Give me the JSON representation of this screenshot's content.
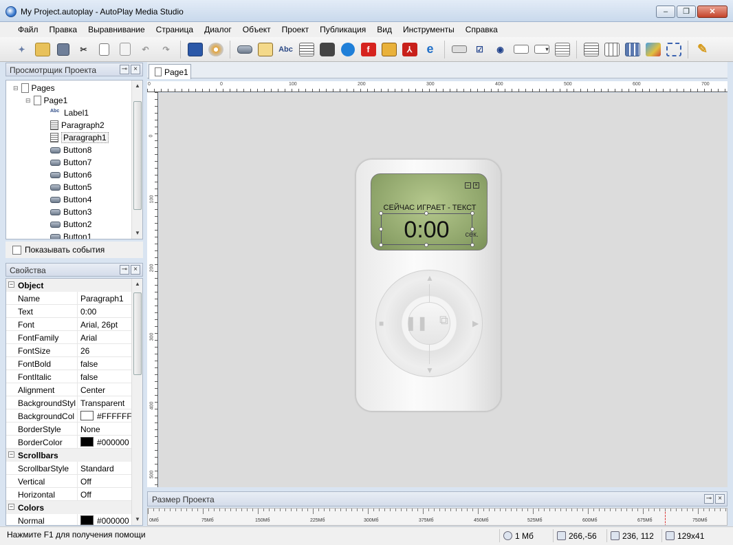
{
  "window": {
    "title": "My Project.autoplay - AutoPlay Media Studio",
    "minimize": "‒",
    "maximize": "❐",
    "close": "✕"
  },
  "menu": [
    "Файл",
    "Правка",
    "Выравнивание",
    "Страница",
    "Диалог",
    "Объект",
    "Проект",
    "Публикация",
    "Вид",
    "Инструменты",
    "Справка"
  ],
  "toolbar": {
    "text_label_icon": "Abc",
    "icons": [
      "wizard-icon",
      "open-folder-icon",
      "save-icon",
      "cut-icon",
      "copy-icon",
      "paste-icon",
      "undo-icon",
      "redo-icon",
      "preview-icon",
      "build-cd-icon",
      "button-object-icon",
      "image-object-icon",
      "label-object-icon",
      "paragraph-object-icon",
      "video-object-icon",
      "quicktime-object-icon",
      "flash-object-icon",
      "slideshow-object-icon",
      "pdf-object-icon",
      "web-object-icon",
      "input-object-icon",
      "checkbox-object-icon",
      "radio-object-icon",
      "input-text-object-icon",
      "combobox-object-icon",
      "listbox-object-icon",
      "grid-object-icon",
      "table-object-icon",
      "tree-object-icon",
      "plugin-object-icon",
      "select-object-icon",
      "pencil-icon"
    ]
  },
  "project_viewer": {
    "title": "Просмотрщик Проекта",
    "tree": [
      {
        "label": "Pages",
        "type": "pages",
        "level": 0
      },
      {
        "label": "Page1",
        "type": "page",
        "level": 1
      },
      {
        "label": "Label1",
        "type": "label",
        "level": 2
      },
      {
        "label": "Paragraph2",
        "type": "paragraph",
        "level": 2
      },
      {
        "label": "Paragraph1",
        "type": "paragraph",
        "level": 2,
        "selected": true
      },
      {
        "label": "Button8",
        "type": "button",
        "level": 2
      },
      {
        "label": "Button7",
        "type": "button",
        "level": 2
      },
      {
        "label": "Button6",
        "type": "button",
        "level": 2
      },
      {
        "label": "Button5",
        "type": "button",
        "level": 2
      },
      {
        "label": "Button4",
        "type": "button",
        "level": 2
      },
      {
        "label": "Button3",
        "type": "button",
        "level": 2
      },
      {
        "label": "Button2",
        "type": "button",
        "level": 2
      },
      {
        "label": "Button1",
        "type": "button",
        "level": 2
      }
    ],
    "label_icon_text": "Abc",
    "show_events": "Показывать события"
  },
  "properties": {
    "title": "Свойства",
    "rows": [
      {
        "category": "Object"
      },
      {
        "key": "Name",
        "value": "Paragraph1"
      },
      {
        "key": "Text",
        "value": "0:00"
      },
      {
        "key": "Font",
        "value": "Arial, 26pt"
      },
      {
        "key": "FontFamily",
        "value": "Arial"
      },
      {
        "key": "FontSize",
        "value": "26"
      },
      {
        "key": "FontBold",
        "value": "false"
      },
      {
        "key": "FontItalic",
        "value": "false"
      },
      {
        "key": "Alignment",
        "value": "Center"
      },
      {
        "key": "BackgroundStyl",
        "value": "Transparent"
      },
      {
        "key": "BackgroundCol",
        "value": "#FFFFFF",
        "swatch": "#FFFFFF"
      },
      {
        "key": "BorderStyle",
        "value": "None"
      },
      {
        "key": "BorderColor",
        "value": "#000000",
        "swatch": "#000000"
      },
      {
        "category": "Scrollbars"
      },
      {
        "key": "ScrollbarStyle",
        "value": "Standard"
      },
      {
        "key": "Vertical",
        "value": "Off"
      },
      {
        "key": "Horizontal",
        "value": "Off"
      },
      {
        "category": "Colors"
      },
      {
        "key": "Normal",
        "value": "#000000",
        "swatch": "#000000"
      }
    ]
  },
  "document": {
    "tab": "Page1",
    "ruler_h": [
      "0",
      "0",
      "100",
      "200",
      "300",
      "400",
      "500",
      "600",
      "700"
    ],
    "ruler_v": [
      "0",
      "100",
      "200",
      "300",
      "400",
      "500"
    ],
    "player": {
      "now_playing": "СЕЙЧАС ИГРАЕТ - ТЕКСТ",
      "time": "0:00",
      "sec_label": "сек.",
      "minimize": "–",
      "close": "×"
    }
  },
  "project_size": {
    "title": "Размер Проекта",
    "labels": [
      "0Мб",
      "75Мб",
      "150Мб",
      "225Мб",
      "300Мб",
      "375Мб",
      "450Мб",
      "525Мб",
      "600Мб",
      "675Мб",
      "750Мб"
    ]
  },
  "status": {
    "help": "Нажмите F1 для получения помощи",
    "size": "1 Мб",
    "cursor": "266,-56",
    "position": "236, 112",
    "dimensions": "129x41"
  },
  "colors": {
    "accent": "#3b7bd0",
    "screen": "#9fb47a",
    "canvas": "#dcdcdc"
  }
}
